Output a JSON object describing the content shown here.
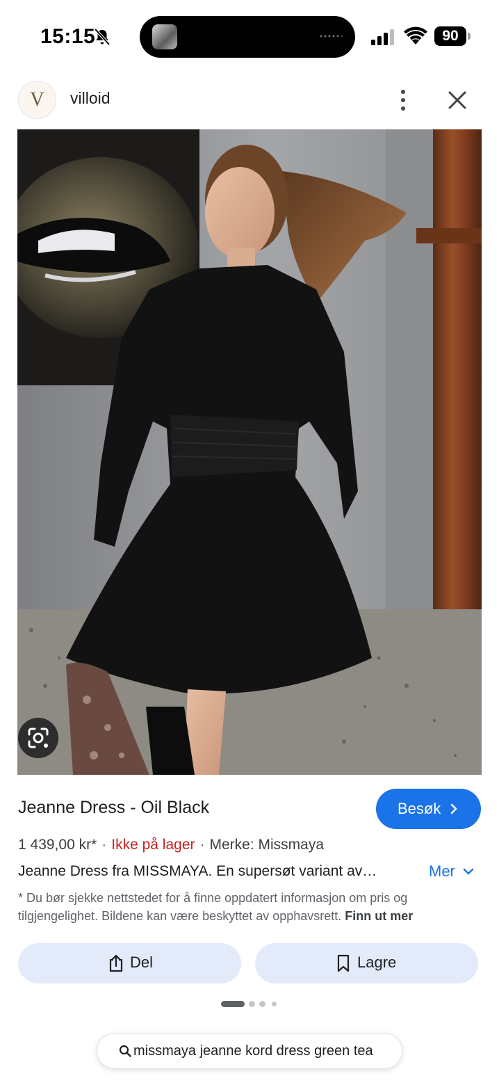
{
  "status_bar": {
    "time": "15:15",
    "battery": "90"
  },
  "site": {
    "avatar_letter": "V",
    "name": "villoid"
  },
  "product": {
    "title": "Jeanne Dress - Oil Black",
    "visit_label": "Besøk",
    "price": "1 439,00 kr*",
    "separator": "·",
    "stock": "Ikke på lager",
    "brand": "Merke: Missmaya",
    "description": "Jeanne Dress fra MISSMAYA. En supersøt variant av…",
    "more_label": "Mer",
    "disclaimer": "* Du bør sjekke nettstedet for å finne oppdatert informasjon om pris og tilgjengelighet. Bildene kan være beskyttet av opphavsrett.",
    "learn_more": "Finn ut mer"
  },
  "actions": {
    "share_label": "Del",
    "save_label": "Lagre"
  },
  "search": {
    "query": "missmaya jeanne kord dress green tea"
  },
  "colors": {
    "accent": "#1a73e8",
    "stock_status": "#c5221f",
    "action_button_bg": "#e3ebfb"
  },
  "icons": [
    "mute-icon",
    "signal-icon",
    "wifi-icon",
    "more-vertical-icon",
    "close-icon",
    "lens-icon",
    "chevron-right-icon",
    "chevron-down-icon",
    "share-icon",
    "bookmark-icon",
    "search-icon"
  ]
}
